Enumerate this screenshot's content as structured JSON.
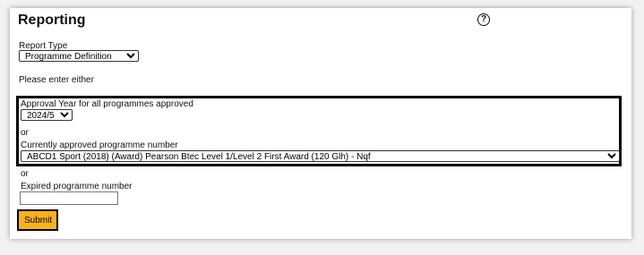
{
  "header": {
    "title": "Reporting",
    "help_icon": "question-circle-icon",
    "help_glyph": "?"
  },
  "report_type": {
    "label": "Report Type",
    "selected": "Programme Definition"
  },
  "instruction": "Please enter either",
  "approval_year": {
    "label": "Approval Year for all programmes approved",
    "selected": "2024/5"
  },
  "separator_1": "or",
  "current_programme": {
    "label": "Currently approved programme number",
    "selected": "ABCD1 Sport (2018) (Award) Pearson Btec Level 1/Level 2 First Award (120 Glh) - Nqf"
  },
  "separator_2": "or",
  "expired_programme": {
    "label": "Expired programme number",
    "value": ""
  },
  "submit": {
    "label": "Submit"
  },
  "colors": {
    "submit_background": "#f7b21c",
    "highlight_border": "#000000"
  }
}
